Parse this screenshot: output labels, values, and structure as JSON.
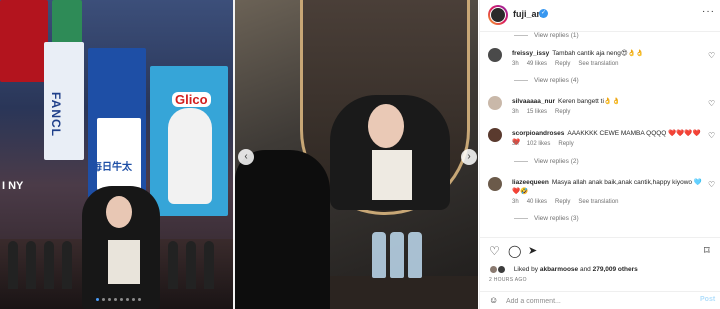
{
  "post": {
    "username": "fuji_an"
  },
  "media": {
    "left_signs": {
      "fancl": "FANCL",
      "mainichi": "毎日牛太",
      "glico": "Glico",
      "ny": "I NY"
    },
    "carousel_dots": 8,
    "active_dot": 0
  },
  "comments": [
    {
      "type": "replies",
      "label": "View replies (1)"
    },
    {
      "type": "comment",
      "user": "freissy_issy",
      "text": "Tambah cantik aja neng😍👌👌",
      "time": "3h",
      "likes": "49 likes",
      "reply": "Reply",
      "translate": "See translation"
    },
    {
      "type": "replies",
      "label": "View replies (4)"
    },
    {
      "type": "comment",
      "user": "silvaaaaa_nur",
      "text": "Keren bangett ti👌👌",
      "time": "3h",
      "likes": "15 likes",
      "reply": "Reply",
      "translate": ""
    },
    {
      "type": "comment",
      "user": "scorpioandroses",
      "text": "AAAKKKK CEWE MAMBA QQQQ ❤️❤️❤️❤️❤️",
      "time": "3h",
      "likes": "102 likes",
      "reply": "Reply",
      "translate": ""
    },
    {
      "type": "replies",
      "label": "View replies (2)"
    },
    {
      "type": "comment",
      "user": "liazeequeen",
      "text": "Masya allah anak baik,anak cantik,happy kiyowo 🩵❤️🤣",
      "time": "3h",
      "likes": "40 likes",
      "reply": "Reply",
      "translate": "See translation"
    },
    {
      "type": "replies",
      "label": "View replies (3)"
    }
  ],
  "actions": {
    "liked_by_prefix": "Liked by",
    "liked_by_user": "akbarmoose",
    "and_label": "and",
    "others": "279,009 others",
    "time_ago": "2 HOURS AGO"
  },
  "add_comment": {
    "placeholder": "Add a comment...",
    "post_label": "Post"
  },
  "colors": {
    "verified": "#3897f0",
    "post_button": "#b2dffc",
    "active_dot": "#4a9df8"
  }
}
